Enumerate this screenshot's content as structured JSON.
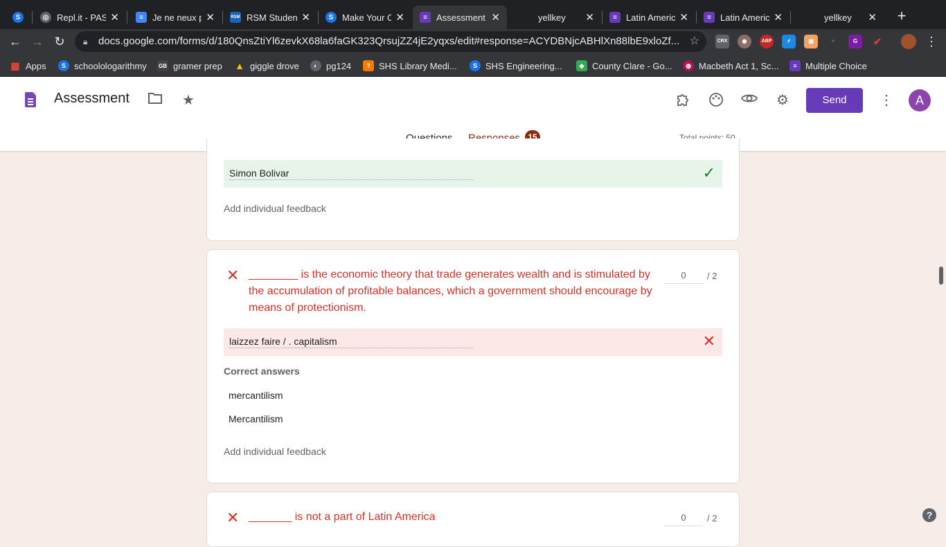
{
  "browser": {
    "tabs": [
      {
        "title": "",
        "icon": "s-icon",
        "color": "#1a73e8"
      },
      {
        "title": "Repl.it - PAS",
        "icon": "repl-icon",
        "color": "#5f6368"
      },
      {
        "title": "Je ne neux p",
        "icon": "docs-icon",
        "color": "#4285f4"
      },
      {
        "title": "RSM Student",
        "icon": "rsm-icon",
        "color": "#1565c0"
      },
      {
        "title": "Make Your O",
        "icon": "s-icon",
        "color": "#1a73e8"
      },
      {
        "title": "Assessment",
        "icon": "forms-icon",
        "color": "#673ab7"
      },
      {
        "title": "yellkey",
        "icon": "blank-icon",
        "color": "#202124"
      },
      {
        "title": "Latin Americ",
        "icon": "forms-icon",
        "color": "#673ab7"
      },
      {
        "title": "Latin Americ",
        "icon": "forms-icon",
        "color": "#673ab7"
      },
      {
        "title": "yellkey",
        "icon": "blank-icon",
        "color": "#202124"
      }
    ],
    "url": "docs.google.com/forms/d/180QnsZtiYl6zevkX68la6faGK323QrsujZZ4jE2yqxs/edit#response=ACYDBNjcABHlXn88lbE9xloZf...",
    "extensions": [
      {
        "name": "crx-icon",
        "label": "CRX",
        "color": "#5f6368"
      },
      {
        "name": "owl-icon",
        "label": "",
        "color": "#8d6e63"
      },
      {
        "name": "abp-icon",
        "label": "ABP",
        "color": "#c62828"
      },
      {
        "name": "bolt-icon",
        "label": "",
        "color": "#1e88e5"
      },
      {
        "name": "box-icon",
        "label": "",
        "color": "#f4a261"
      },
      {
        "name": "leaf-icon",
        "label": "",
        "color": "#2e7d32"
      },
      {
        "name": "color-icon",
        "label": "",
        "color": "#7b1fa2"
      },
      {
        "name": "check-ext-icon",
        "label": "",
        "color": "#c62828"
      }
    ],
    "bookmarks": [
      {
        "label": "Apps",
        "icon": "apps-icon",
        "color": "#ea4335"
      },
      {
        "label": "schoolologarithmy",
        "icon": "s-icon",
        "color": "#1a73e8"
      },
      {
        "label": "gramer prep",
        "icon": "gb-icon",
        "color": "#424242"
      },
      {
        "label": "giggle drove",
        "icon": "drive-icon",
        "color": "#fbbc04"
      },
      {
        "label": "pg124",
        "icon": "globe-icon",
        "color": "#5f6368"
      },
      {
        "label": "SHS Library Medi...",
        "icon": "library-icon",
        "color": "#f57c00"
      },
      {
        "label": "SHS Engineering...",
        "icon": "s-icon",
        "color": "#1a73e8"
      },
      {
        "label": "County Clare - Go...",
        "icon": "maps-icon",
        "color": "#34a853"
      },
      {
        "label": "Macbeth Act 1, Sc...",
        "icon": "macbeth-icon",
        "color": "#ad1457"
      },
      {
        "label": "Multiple Choice",
        "icon": "forms-icon",
        "color": "#673ab7"
      }
    ]
  },
  "header": {
    "title": "Assessment",
    "send_label": "Send",
    "avatar_letter": "A",
    "tabs": {
      "questions": "Questions",
      "responses": "Responses",
      "responses_count": "15"
    },
    "total_points": "Total points: 50"
  },
  "cards": {
    "first": {
      "answer": "Simon Bolivar",
      "feedback": "Add individual feedback"
    },
    "second": {
      "question": "________ is the economic theory that trade generates wealth and is stimulated by the accumulation of profitable balances, which a government should encourage by means of protectionism.",
      "points_earned": "0",
      "points_total": "/ 2",
      "answer": "laizzez faire / . capitalism",
      "correct_answers_label": "Correct answers",
      "correct_answers": [
        "mercantilism",
        "Mercantilism"
      ],
      "feedback": "Add individual feedback"
    },
    "third": {
      "question": "_______ is not a part of Latin America",
      "points_earned": "0",
      "points_total": "/ 2"
    }
  },
  "colors": {
    "accent": "#673ab7",
    "responses_accent": "#8a2c0d",
    "correct": "#188038",
    "wrong": "#d93025",
    "page_bg": "#f6ede8"
  }
}
